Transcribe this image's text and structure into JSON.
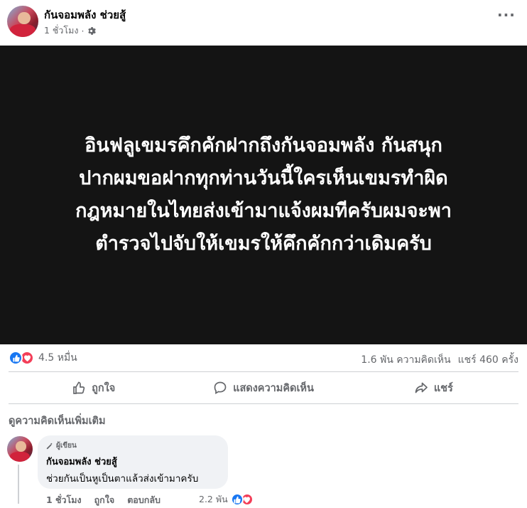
{
  "post": {
    "page_name": "กันจอมพลัง ช่วยสู้",
    "time": "1 ชั่วโมง",
    "separator": "·",
    "privacy_icon": "gear-icon",
    "more_label": "···",
    "image_text_lines": [
      "อินฟลูเขมรคึกคักฝากถึงกันจอมพลัง กันสนุก",
      "ปากผมขอฝากทุกท่านวันนี้ใครเห็นเขมรทำผิด",
      "กฎหมายในไทยส่งเข้ามาแจ้งผมทีครับผมจะพา",
      "ตำรวจไปจับให้เขมรให้คึกคักกว่าเดิมครับ"
    ]
  },
  "stats": {
    "reaction_count": "4.5 หมื่น",
    "comments": "1.6 พัน ความคิดเห็น",
    "shares": "แชร์ 460 ครั้ง"
  },
  "actions": {
    "like": "ถูกใจ",
    "comment": "แสดงความคิดเห็น",
    "share": "แชร์"
  },
  "comments_section": {
    "more_label": "ดูความคิดเห็นเพิ่มเติม",
    "comment": {
      "badge": "ผู้เขียน",
      "author": "กันจอมพลัง ช่วยสู้",
      "text": "ช่วยกันเป็นหูเป็นตาแล้วส่งเข้ามาครับ",
      "time": "1 ชั่วโมง",
      "like": "ถูกใจ",
      "reply": "ตอบกลับ",
      "reaction_count": "2.2 พัน"
    }
  },
  "colors": {
    "like_blue": "#1877f2",
    "love_red": "#f33e58",
    "muted_text": "#65676b",
    "image_bg": "#141414"
  }
}
